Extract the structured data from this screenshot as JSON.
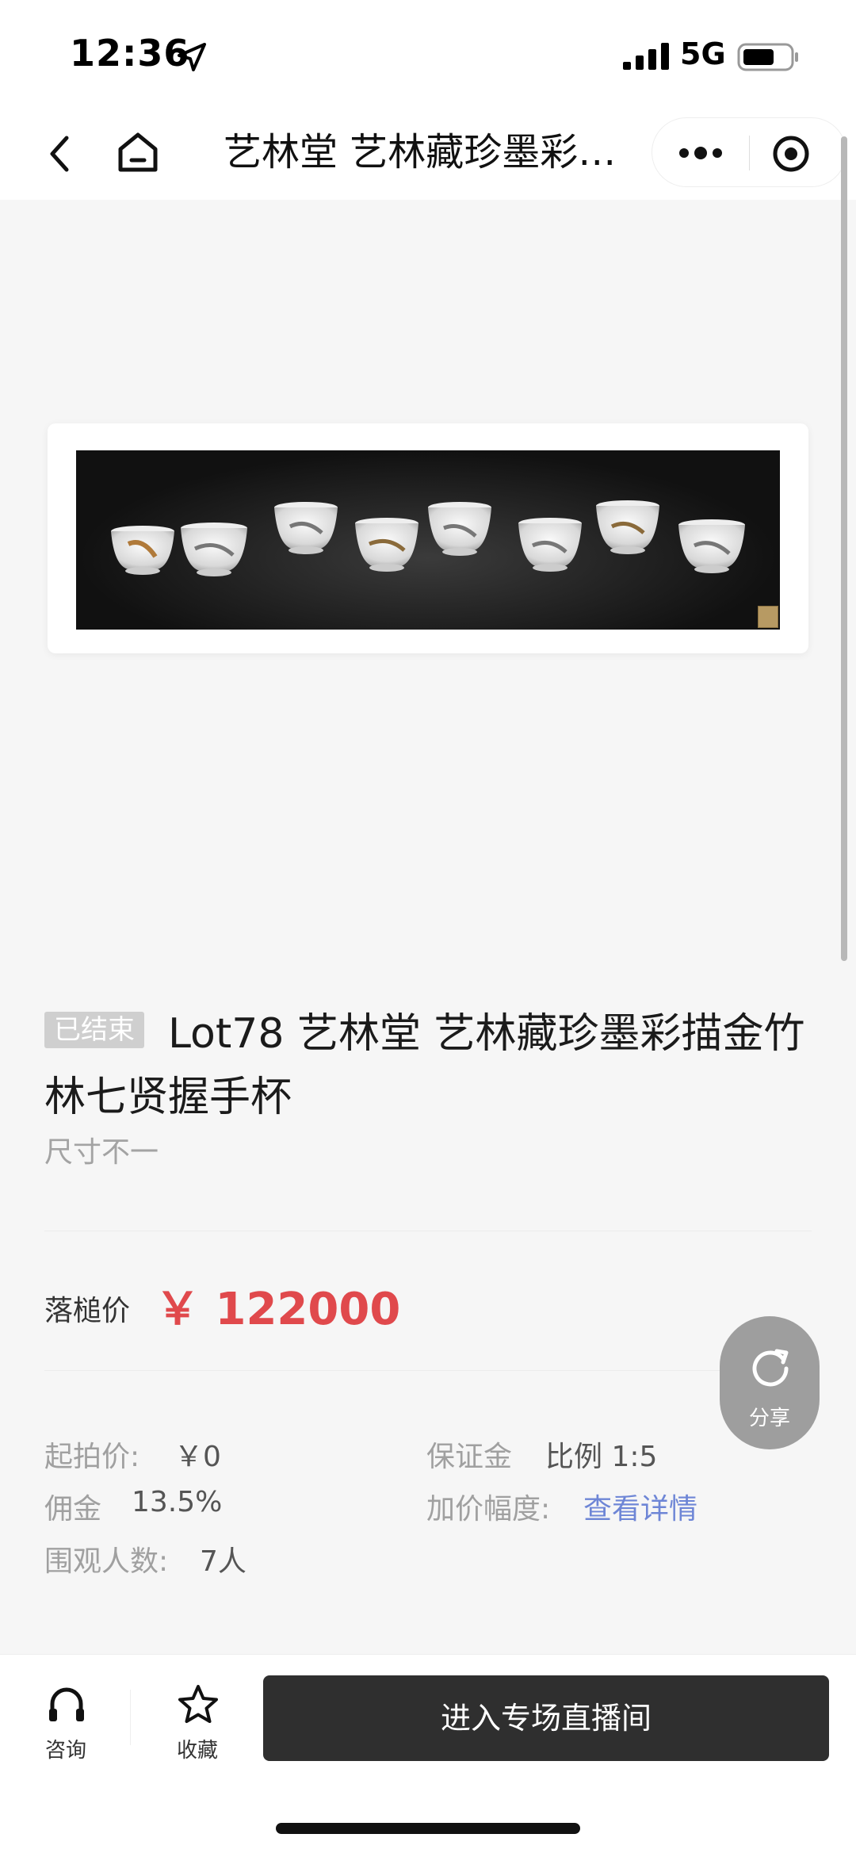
{
  "status_bar": {
    "time": "12:36",
    "network": "5G"
  },
  "nav": {
    "title": "艺林堂 艺林藏珍墨彩描金竹林七贤握手杯"
  },
  "lot": {
    "status_badge": "已结束",
    "title": "Lot78 艺林堂 艺林藏珍墨彩描金竹林七贤握手杯",
    "size": "尺寸不一"
  },
  "price": {
    "label": "落槌价",
    "value": "￥ 122000"
  },
  "details": {
    "start_price_label": "起拍价:",
    "start_price_value": "￥0",
    "deposit_label": "保证金",
    "deposit_value": "比例 1:5",
    "commission_label": "佣金",
    "commission_value": "13.5%",
    "increment_label": "加价幅度:",
    "increment_link": "查看详情",
    "viewers_label": "围观人数:",
    "viewers_value": "7人"
  },
  "share": {
    "label": "分享"
  },
  "bottom_bar": {
    "consult_label": "咨询",
    "favorite_label": "收藏",
    "enter_live_label": "进入专场直播间"
  },
  "colors": {
    "price": "#e0494c",
    "link": "#6e86d6",
    "primary_button": "#2f2f2f"
  },
  "icons": [
    "location-arrow-icon",
    "signal-icon",
    "battery-icon",
    "back-icon",
    "home-icon",
    "more-icon",
    "target-icon",
    "share-refresh-icon",
    "headset-icon",
    "star-icon"
  ]
}
